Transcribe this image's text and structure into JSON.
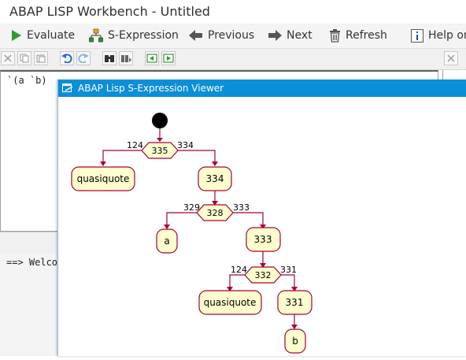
{
  "window": {
    "title": "ABAP LISP Workbench - Untitled"
  },
  "toolbar": {
    "evaluate": "Evaluate",
    "sexpression": "S-Expression",
    "previous": "Previous",
    "next": "Next",
    "refresh": "Refresh",
    "help": "Help on..."
  },
  "editor": {
    "code": "`(a `b)"
  },
  "output": {
    "line": "==> Welco"
  },
  "viewer": {
    "title": "ABAP Lisp S-Expression Viewer",
    "graph": {
      "d335": {
        "label": "335",
        "left": "124",
        "right": "334"
      },
      "n_quasi1": "quasiquote",
      "n334": "334",
      "d328": {
        "label": "328",
        "left": "329",
        "right": "333"
      },
      "n_a": "a",
      "n333": "333",
      "d332": {
        "label": "332",
        "left": "124",
        "right": "331"
      },
      "n_quasi2": "quasiquote",
      "n331": "331",
      "n_b": "b"
    }
  },
  "colors": {
    "accent": "#0a8fd8",
    "node_fill": "#fefece",
    "node_stroke": "#a80036"
  }
}
